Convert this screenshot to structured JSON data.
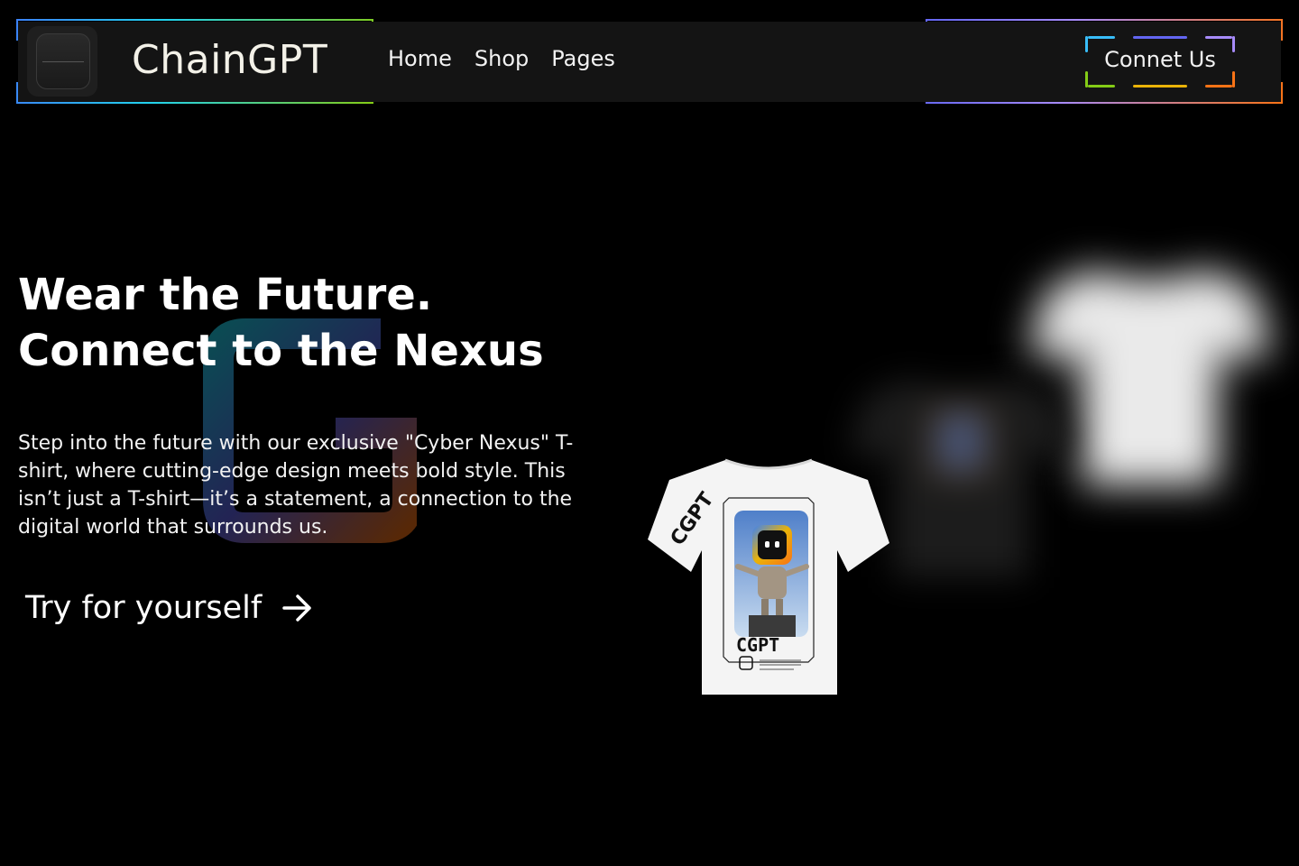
{
  "nav": {
    "brand": "ChainGPT",
    "links": [
      "Home",
      "Shop",
      "Pages"
    ],
    "cta": "Connet Us"
  },
  "hero": {
    "title_line1": "Wear the Future.",
    "title_line2": "Connect to the Nexus",
    "description": "Step into the future with our exclusive \"Cyber Nexus\" T-shirt, where cutting-edge design meets bold style. This isn’t just a T-shirt—it’s a statement, a connection to the digital world that surrounds us.",
    "cta": "Try for yourself"
  },
  "product": {
    "shirt_print_text": "CGPT",
    "sleeve_text": "CGPT"
  },
  "colors": {
    "background": "#000000",
    "nav_bg": "#141414",
    "text": "#ffffff",
    "brand_text": "#f3f1e8"
  }
}
